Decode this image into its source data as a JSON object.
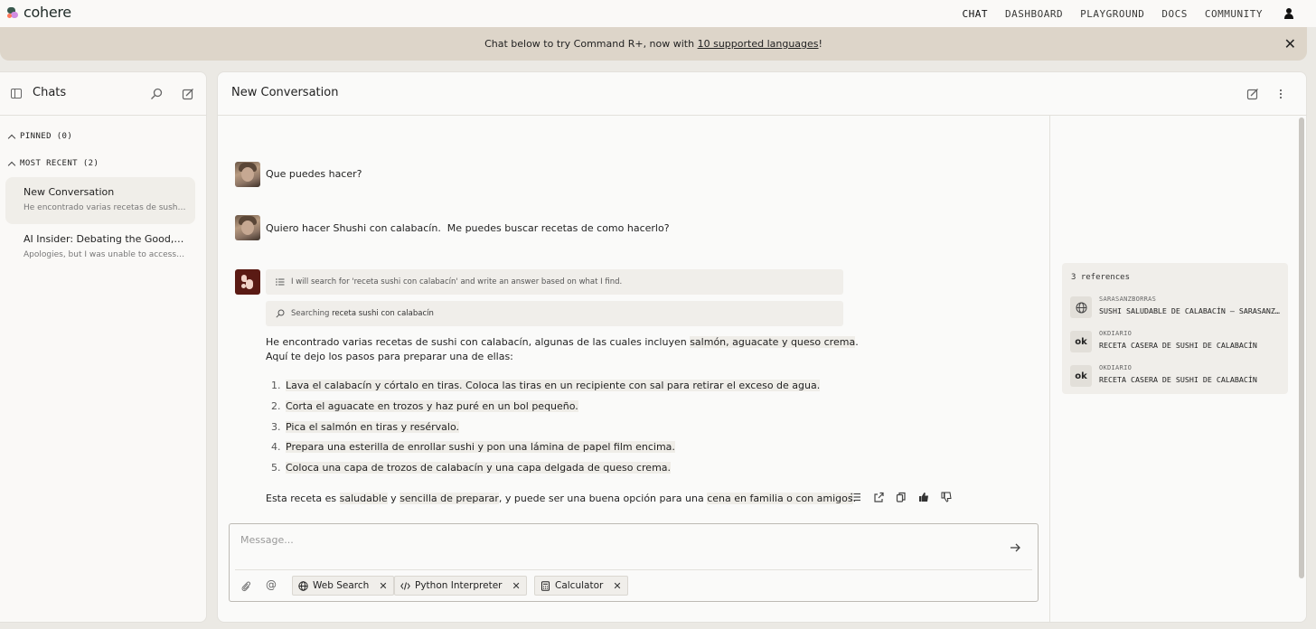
{
  "nav": {
    "logo_text": "cohere",
    "links": [
      "CHAT",
      "DASHBOARD",
      "PLAYGROUND",
      "DOCS",
      "COMMUNITY"
    ]
  },
  "banner": {
    "text_before": "Chat below to try Command R+, now with ",
    "link": "10 supported languages",
    "text_after": "!"
  },
  "sidebar": {
    "title": "Chats",
    "pinned_label": "PINNED (0)",
    "recent_label": "MOST RECENT (2)",
    "conversations": [
      {
        "title": "New Conversation",
        "snippet": "He encontrado varias recetas de sushi con calabacín"
      },
      {
        "title": "AI Insider: Debating the Good, the Bad and the Ugly",
        "snippet": "Apologies, but I was unable to access the"
      }
    ]
  },
  "main": {
    "title": "New Conversation",
    "user_messages": [
      "Que puedes hacer?",
      "Quiero hacer Shushi con calabacín.  Me puedes buscar recetas de como hacerlo?"
    ],
    "tool_plan": "I will search for 'receta sushi con calabacín' and write an answer based on what I find.",
    "tool_search_prefix": "Searching",
    "tool_search_query": "receta sushi con calabacín",
    "answer": {
      "intro_1": "He encontrado varias recetas de sushi con calabacín, algunas de las cuales incluyen ",
      "intro_cite": "salmón, aguacate y queso crema",
      "intro_2": ".",
      "intro_line2": "Aquí te dejo los pasos para preparar una de ellas:",
      "steps": [
        {
          "num": "1.",
          "text": "Lava el calabacín y córtalo en tiras. Coloca las tiras en un recipiente con sal para retirar el exceso de agua."
        },
        {
          "num": "2.",
          "text": "Corta el aguacate en trozos y haz puré en un bol pequeño."
        },
        {
          "num": "3.",
          "text": "Pica el salmón en tiras y resérvalo."
        },
        {
          "num": "4.",
          "text": "Prepara una esterilla de enrollar sushi y pon una lámina de papel film encima."
        },
        {
          "num": "5.",
          "text": "Coloca una capa de trozos de calabacín y una capa delgada de queso crema."
        }
      ],
      "outro_1": "Esta receta es ",
      "outro_c1": "saludable",
      "outro_2": " y ",
      "outro_c2": "sencilla de preparar",
      "outro_3": ", y puede ser una buena opción para una ",
      "outro_c3": "cena en familia o con amigos",
      "outro_4": "."
    },
    "references": {
      "count_label": "3 references",
      "items": [
        {
          "icon": "globe-icon",
          "source": "SARASANZBORRAS",
          "title": "SUSHI SALUDABLE DE CALABACÍN – SARASANZBORRAS"
        },
        {
          "icon": "ok",
          "source": "OKDIARIO",
          "title": "RECETA CASERA DE SUSHI DE CALABACÍN"
        },
        {
          "icon": "ok",
          "source": "OKDIARIO",
          "title": "RECETA CASERA DE SUSHI DE CALABACÍN"
        }
      ]
    },
    "composer": {
      "placeholder": "Message...",
      "tools": [
        "Web Search",
        "Python Interpreter",
        "Calculator"
      ]
    }
  }
}
